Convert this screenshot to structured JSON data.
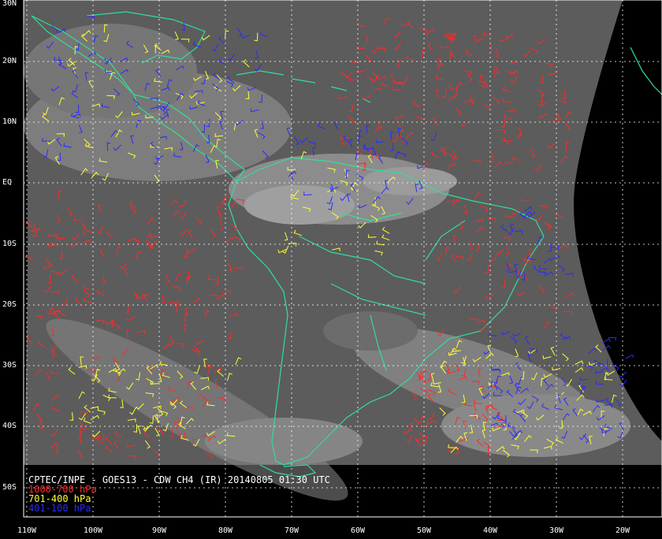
{
  "caption": {
    "title": "CPTEC/INPE - GOES13 - CDW CH4 (IR) 20140805 01:30 UTC"
  },
  "legend": [
    {
      "label": "1000-700 hPa",
      "color": "#ff2a2a"
    },
    {
      "label": "701-400 hPa",
      "color": "#ffff33"
    },
    {
      "label": "401-100 hPa",
      "color": "#2b2bff"
    }
  ],
  "latitude_labels": [
    "30N",
    "20N",
    "10N",
    "EQ",
    "10S",
    "20S",
    "30S",
    "40S",
    "50S"
  ],
  "longitude_labels": [
    "110W",
    "100W",
    "90W",
    "80W",
    "70W",
    "60W",
    "50W",
    "40W",
    "30W",
    "20W"
  ],
  "colors": {
    "background": "#000000",
    "grid": "#ffffff",
    "coastline": "#33dd99",
    "satellite_gray": "#5a5a5a"
  }
}
